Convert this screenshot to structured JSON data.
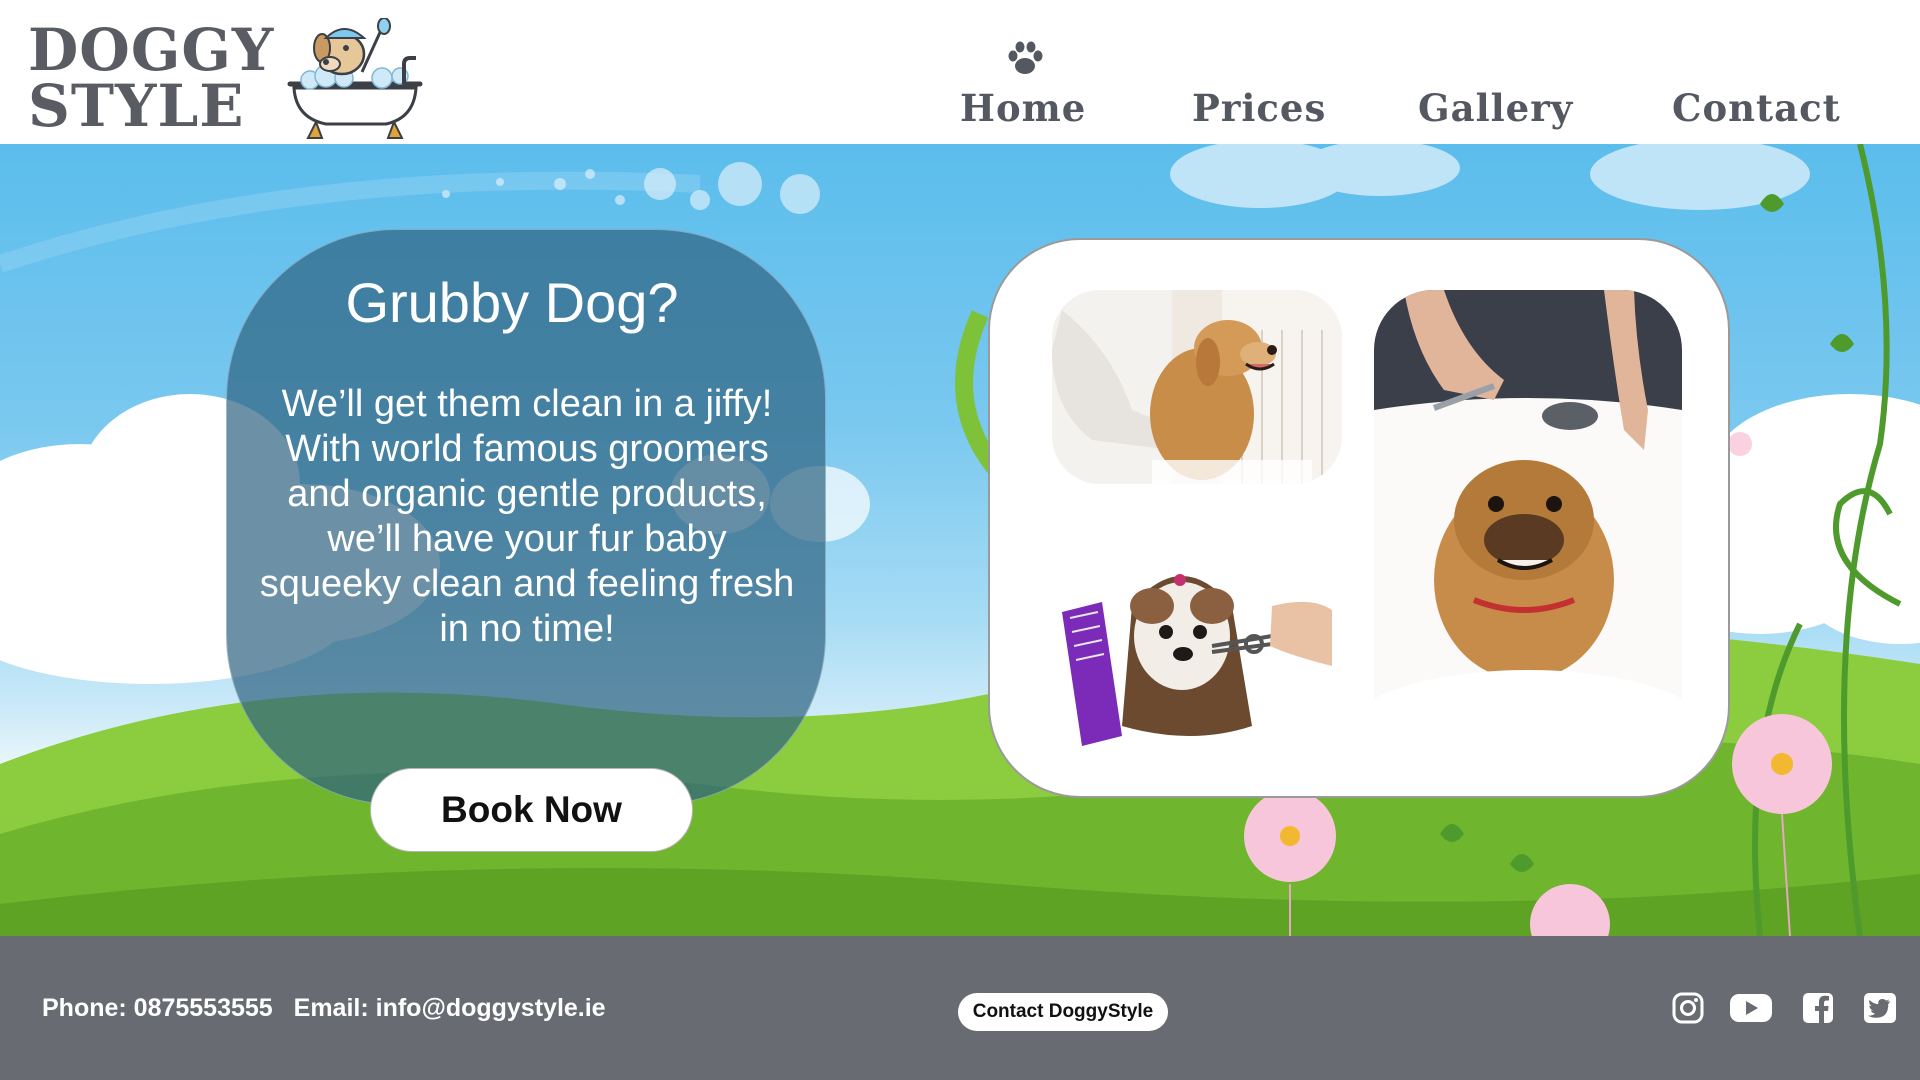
{
  "brand": {
    "logo_line1": "DOGGY",
    "logo_line2": "STYLE"
  },
  "nav": {
    "items": [
      {
        "label": "Home",
        "active": true
      },
      {
        "label": "Prices"
      },
      {
        "label": "Gallery"
      },
      {
        "label": "Contact"
      }
    ],
    "active_icon": "paw-icon"
  },
  "hero": {
    "title": "Grubby Dog?",
    "body": "We’ll get them clean in a jiffy! With world famous groomers and organic gentle products, we’ll have your fur baby squeeky clean and feeling fresh in no time!",
    "cta_label": "Book Now",
    "photos": [
      "dog-being-washed-photo",
      "dog-haircut-photo",
      "bulldog-bath-photo"
    ]
  },
  "footer": {
    "phone": "Phone: 0875553555",
    "email": "Email: info@doggystyle.ie",
    "contact_button": "Contact DoggyStyle",
    "social": [
      "instagram-icon",
      "youtube-icon",
      "facebook-icon",
      "twitter-icon"
    ]
  },
  "colors": {
    "brand_gray": "#595c63",
    "footer_bg": "#686b72",
    "sky": "#5bbdec",
    "grass": "#7ec23a",
    "card_overlay": "#2d6280"
  }
}
